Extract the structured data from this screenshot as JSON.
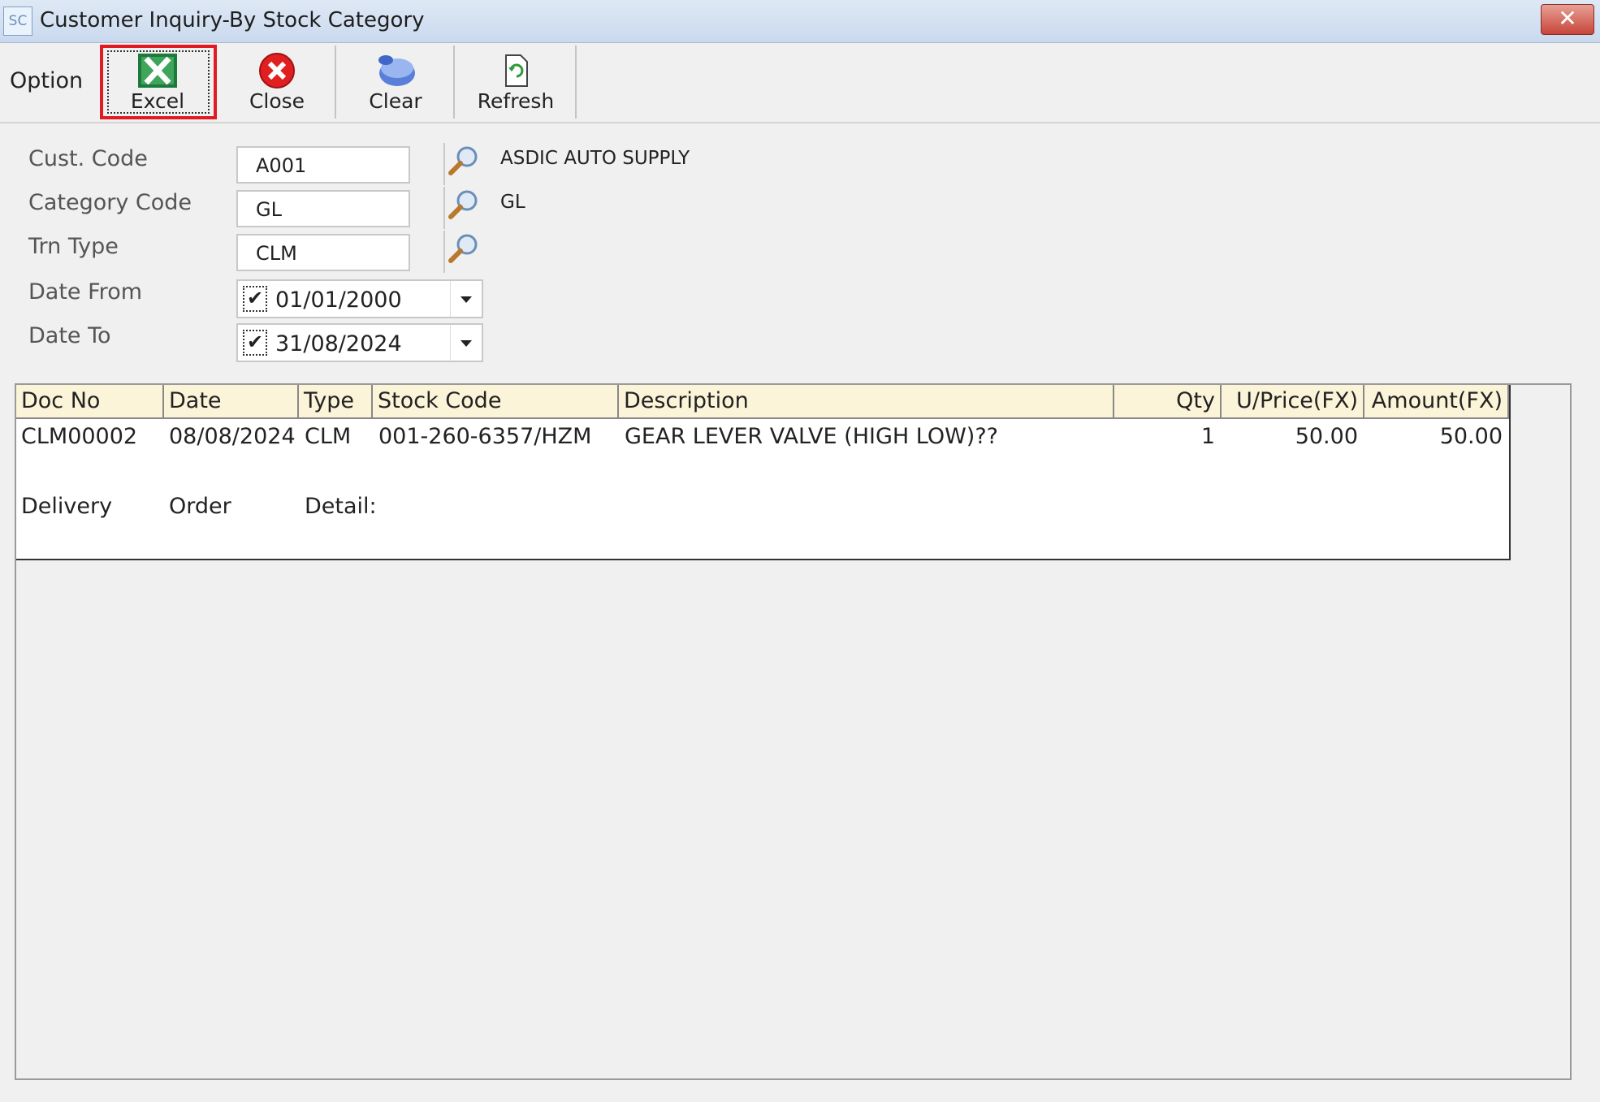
{
  "window": {
    "icon_text": "SC",
    "title": "Customer Inquiry-By Stock Category",
    "close_glyph": "✕"
  },
  "toolbar": {
    "option_label": "Option",
    "excel_label": "Excel",
    "close_label": "Close",
    "clear_label": "Clear",
    "refresh_label": "Refresh"
  },
  "form": {
    "cust_code_label": "Cust. Code",
    "cust_code_value": "A001",
    "cust_name": "ASDIC AUTO SUPPLY",
    "category_code_label": "Category Code",
    "category_code_value": "GL",
    "category_desc": "GL",
    "trn_type_label": "Trn Type",
    "trn_type_value": "CLM",
    "date_from_label": "Date From",
    "date_from_value": "01/01/2000",
    "date_from_checked": true,
    "date_to_label": "Date To",
    "date_to_value": "31/08/2024",
    "date_to_checked": true
  },
  "grid": {
    "columns": [
      "Doc No",
      "Date",
      "Type",
      "Stock Code",
      "Description",
      "Qty",
      "U/Price(FX)",
      "Amount(FX)"
    ],
    "rows": [
      [
        "CLM00002",
        "08/08/2024",
        "CLM",
        "001-260-6357/HZM",
        "GEAR LEVER VALVE (HIGH LOW)??",
        "1",
        "50.00",
        "50.00"
      ]
    ],
    "detail_headers": [
      "Delivery",
      "Order",
      "Detail:"
    ]
  }
}
